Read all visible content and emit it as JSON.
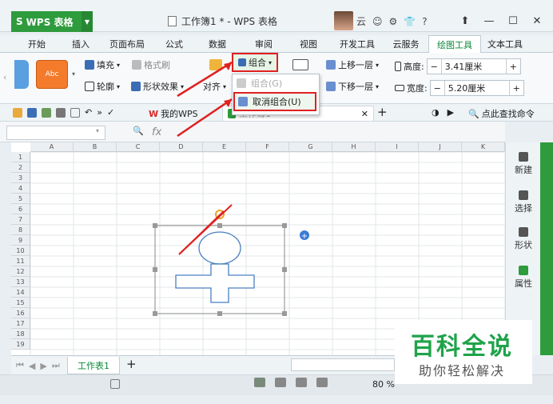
{
  "app": {
    "name": "WPS 表格",
    "doc_title": "工作簿1 * - WPS 表格",
    "user_label": "云"
  },
  "menu_tabs": [
    "开始",
    "插入",
    "页面布局",
    "公式",
    "数据",
    "审阅",
    "视图",
    "开发工具",
    "云服务",
    "绘图工具",
    "文本工具"
  ],
  "ribbon": {
    "style_label": "Abc",
    "fill": "填充",
    "format_brush": "格式刷",
    "outline": "轮廓",
    "shape_effect": "形状效果",
    "align": "对齐",
    "group": "组合",
    "bring_forward": "上移一层",
    "send_backward": "下移一层",
    "height_label": "高度:",
    "height_value": "3.41厘米",
    "width_label": "宽度:",
    "width_value": "5.20厘米"
  },
  "group_menu": {
    "group_item": "组合(G)",
    "ungroup_item": "取消组合(U)"
  },
  "quickbar": {
    "my_wps": "我的WPS",
    "doc_tab": "工作簿1",
    "search": "点此查找命令"
  },
  "formula": {
    "fx": "fx"
  },
  "columns": [
    "A",
    "B",
    "C",
    "D",
    "E",
    "F",
    "G",
    "H",
    "I",
    "J",
    "K"
  ],
  "rows": [
    "1",
    "2",
    "3",
    "4",
    "5",
    "6",
    "7",
    "8",
    "9",
    "10",
    "11",
    "12",
    "13",
    "14",
    "15",
    "16",
    "17",
    "18",
    "19"
  ],
  "side_panel": [
    "新建",
    "选择",
    "形状",
    "属性"
  ],
  "sheet": {
    "tab": "工作表1",
    "add": "+"
  },
  "status": {
    "zoom": "80 %"
  },
  "watermark": {
    "title": "百科全说",
    "subtitle": "助你轻松解决"
  },
  "colors": {
    "accent_green": "#2e9b3d",
    "highlight_red": "#e02020",
    "shape_blue": "#4a7fc1",
    "orange": "#f47b2b"
  }
}
